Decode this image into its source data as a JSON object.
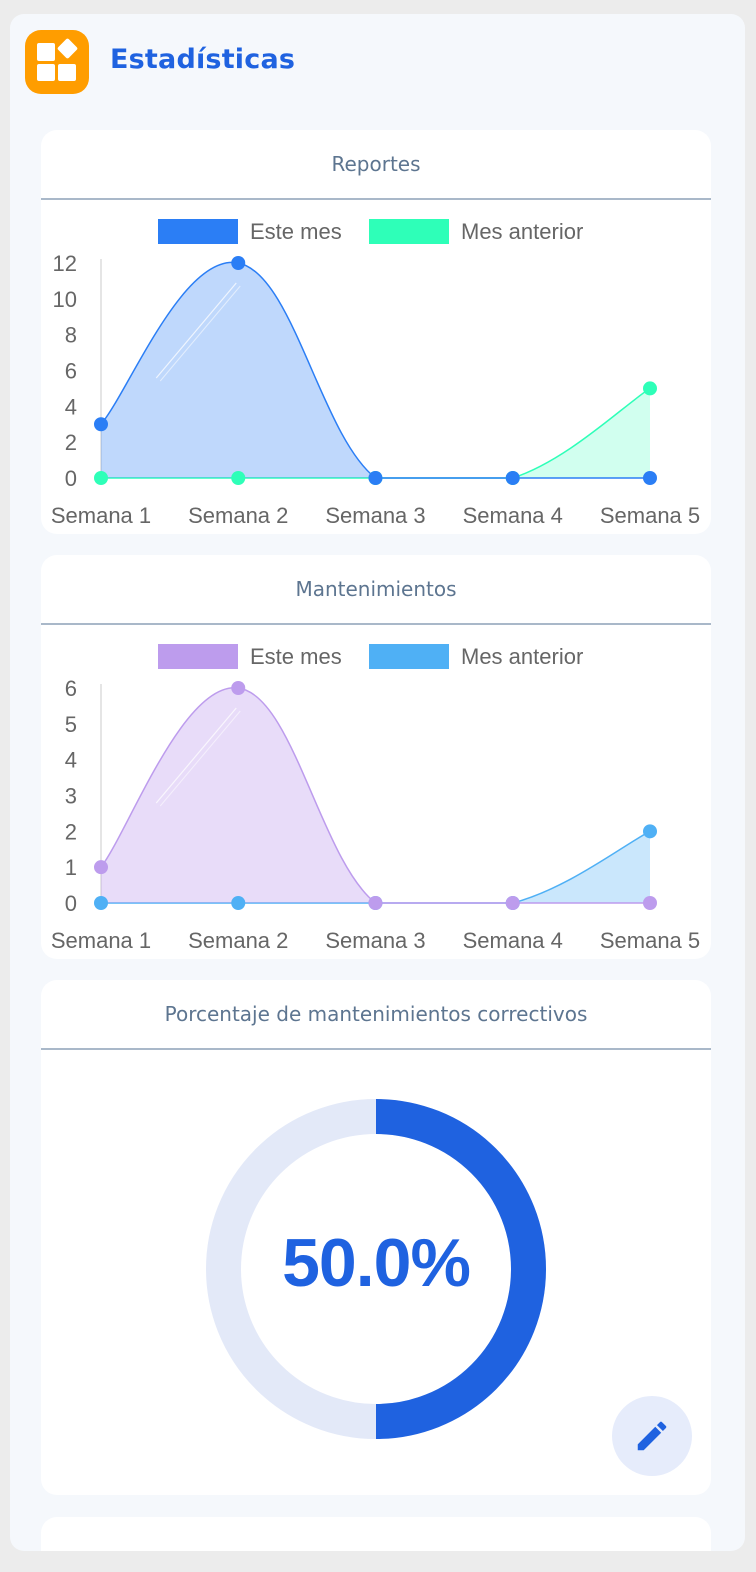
{
  "header": {
    "title": "Estadísticas",
    "icon": "dashboard-icon",
    "accent": "#ff9d00"
  },
  "charts": [
    {
      "card_title": "Reportes",
      "chart_data": {
        "type": "area",
        "categories": [
          "Semana 1",
          "Semana 2",
          "Semana 3",
          "Semana 4",
          "Semana 5"
        ],
        "series": [
          {
            "name": "Este mes",
            "values": [
              3,
              12,
              0,
              0,
              0
            ],
            "color": "#2b7ef5",
            "fill": "rgba(43,126,245,0.30)"
          },
          {
            "name": "Mes anterior",
            "values": [
              0,
              0,
              0,
              0,
              5
            ],
            "color": "#2effb8",
            "fill": "rgba(46,255,184,0.22)"
          }
        ],
        "yticks": [
          0,
          2,
          4,
          6,
          8,
          10,
          12
        ],
        "ylim": [
          0,
          12
        ],
        "legend": "top-center"
      }
    },
    {
      "card_title": "Mantenimientos",
      "chart_data": {
        "type": "area",
        "categories": [
          "Semana 1",
          "Semana 2",
          "Semana 3",
          "Semana 4",
          "Semana 5"
        ],
        "series": [
          {
            "name": "Este mes",
            "values": [
              1,
              6,
              0,
              0,
              0
            ],
            "color": "#bd9ced",
            "fill": "rgba(189,156,237,0.35)"
          },
          {
            "name": "Mes anterior",
            "values": [
              0,
              0,
              0,
              0,
              2
            ],
            "color": "#4fb0f5",
            "fill": "rgba(79,176,245,0.30)"
          }
        ],
        "yticks": [
          0,
          1,
          2,
          3,
          4,
          5,
          6
        ],
        "ylim": [
          0,
          6
        ],
        "legend": "top-center"
      }
    }
  ],
  "donut": {
    "card_title": "Porcentaje de mantenimientos correctivos",
    "value_text": "50.0%",
    "fraction": 0.5,
    "color": "#1f62e0",
    "track_color": "#e3e9f8",
    "edit_icon": "pencil-icon"
  }
}
